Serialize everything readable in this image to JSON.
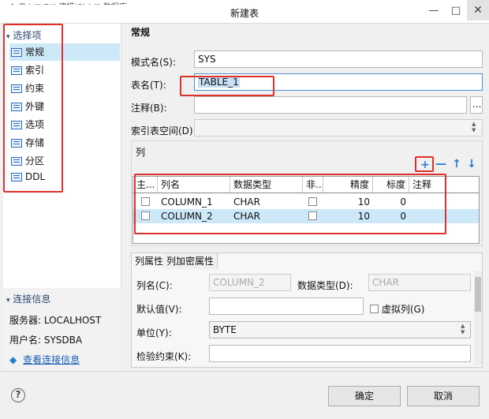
{
  "window": {
    "crumbs": "↔ ↑ 户 | ■ PXJ 建模(S) | ■ 数据库 …",
    "title": "新建表",
    "minimize": "—",
    "maximize": "□",
    "close": "✕"
  },
  "nav": {
    "header": "选择项",
    "items": [
      {
        "label": "常规"
      },
      {
        "label": "索引"
      },
      {
        "label": "约束"
      },
      {
        "label": "外键"
      },
      {
        "label": "选项"
      },
      {
        "label": "存储"
      },
      {
        "label": "分区"
      },
      {
        "label": "DDL"
      }
    ]
  },
  "connection": {
    "header": "连接信息",
    "server": "服务器: LOCALHOST",
    "user": "用户名: SYSDBA",
    "link": "查看连接信息"
  },
  "general": {
    "section": "常规",
    "schema_label": "模式名(S):",
    "schema_value": "SYS",
    "table_label": "表名(T):",
    "table_value": "TABLE_1",
    "comment_label": "注释(B):",
    "comment_value": "",
    "comment_button": "...",
    "tablespace_label": "索引表空间(D):",
    "tablespace_value": ""
  },
  "columns": {
    "section": "列",
    "headers": [
      "主...",
      "列名",
      "数据类型",
      "非...",
      "精度",
      "标度",
      "注释"
    ],
    "rows": [
      {
        "name": "COLUMN_1",
        "type": "CHAR",
        "precision": "10",
        "scale": "0",
        "comment": ""
      },
      {
        "name": "COLUMN_2",
        "type": "CHAR",
        "precision": "10",
        "scale": "0",
        "comment": ""
      }
    ],
    "toolbar": {
      "add": "+",
      "remove": "—",
      "up": "↑",
      "down": "↓"
    }
  },
  "props": {
    "tabs": [
      "列属性",
      "列加密属性"
    ],
    "colname_label": "列名(C):",
    "colname_value": "COLUMN_2",
    "datatype_label": "数据类型(D):",
    "datatype_value": "CHAR",
    "default_label": "默认值(V):",
    "virtual_label": "虚拟列(G)",
    "unit_label": "单位(Y):",
    "unit_value": "BYTE",
    "check_label": "检验约束(K):"
  },
  "footer": {
    "help": "?",
    "ok": "确定",
    "cancel": "取消"
  },
  "colors": {
    "highlight": "#e0302c",
    "selection": "#cde8f8",
    "accent": "#2a7bd2"
  }
}
